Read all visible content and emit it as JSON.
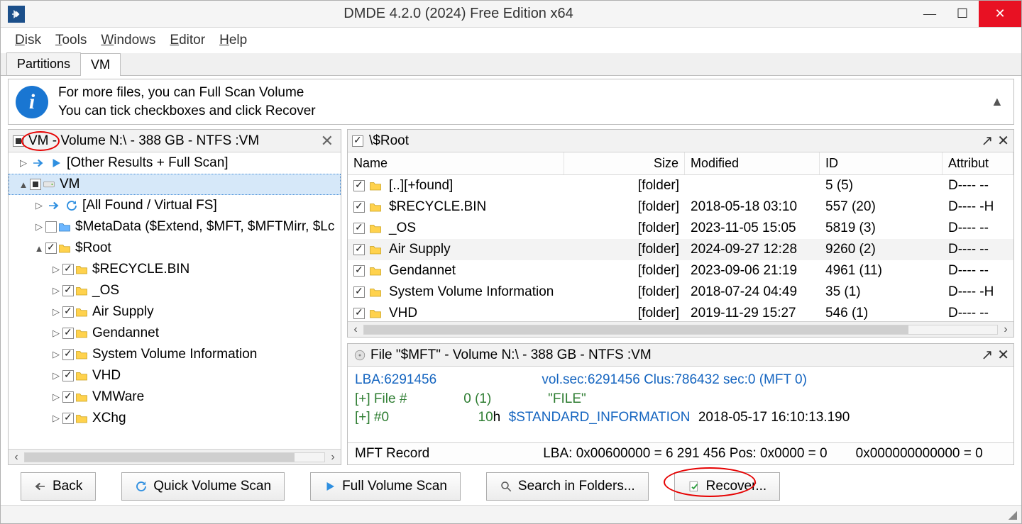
{
  "titlebar": {
    "title": "DMDE 4.2.0 (2024) Free Edition x64"
  },
  "menu": {
    "disk": "Disk",
    "tools": "Tools",
    "windows": "Windows",
    "editor": "Editor",
    "help": "Help"
  },
  "tabs": {
    "partitions": "Partitions",
    "vm": "VM"
  },
  "info": {
    "line1": "For more files, you can Full Scan Volume",
    "line2": "You can tick checkboxes and click Recover"
  },
  "left": {
    "header": "VM - Volume N:\\ - 388 GB - NTFS :VM",
    "nodes": {
      "other": "[Other Results + Full Scan]",
      "vm": "VM",
      "allfound": "[All Found / Virtual FS]",
      "metadata": "$MetaData ($Extend, $MFT, $MFTMirr, $Lc",
      "root": "$Root",
      "recycle": "$RECYCLE.BIN",
      "os": "_OS",
      "airsupply": "Air Supply",
      "gendannet": "Gendannet",
      "svi": "System Volume Information",
      "vhd": "VHD",
      "vmware": "VMWare",
      "xchg": "XChg"
    }
  },
  "listHeader": {
    "path": "\\$Root"
  },
  "grid": {
    "cols": {
      "name": "Name",
      "size": "Size",
      "mod": "Modified",
      "id": "ID",
      "attr": "Attribut"
    },
    "rows": [
      {
        "name": "[..][+found]",
        "size": "[folder]",
        "mod": "",
        "id": "5 (5)",
        "attr": "D---- --"
      },
      {
        "name": "$RECYCLE.BIN",
        "size": "[folder]",
        "mod": "2018-05-18 03:10",
        "id": "557 (20)",
        "attr": "D---- -H"
      },
      {
        "name": "_OS",
        "size": "[folder]",
        "mod": "2023-11-05 15:05",
        "id": "5819 (3)",
        "attr": "D---- --"
      },
      {
        "name": "Air Supply",
        "size": "[folder]",
        "mod": "2024-09-27 12:28",
        "id": "9260 (2)",
        "attr": "D---- --"
      },
      {
        "name": "Gendannet",
        "size": "[folder]",
        "mod": "2023-09-06 21:19",
        "id": "4961 (11)",
        "attr": "D---- --"
      },
      {
        "name": "System Volume Information",
        "size": "[folder]",
        "mod": "2018-07-24 04:49",
        "id": "35 (1)",
        "attr": "D---- -H"
      },
      {
        "name": "VHD",
        "size": "[folder]",
        "mod": "2019-11-29 15:27",
        "id": "546 (1)",
        "attr": "D---- --"
      }
    ]
  },
  "detail": {
    "title": "File \"$MFT\" - Volume N:\\ - 388 GB - NTFS :VM",
    "line1a": "LBA:6291456",
    "line1b": "vol.sec:6291456 Clus:786432 sec:0 (MFT 0)",
    "line2a": "[+] File #",
    "line2b": "0 (1)",
    "line2c": "\"FILE\"",
    "line3a": "[+] #0",
    "line3b": "10",
    "line3c": "h",
    "line3d": "$STANDARD_INFORMATION",
    "line3e": "2018-05-17 16:10:13.190",
    "status_a": "MFT Record",
    "status_b": "LBA: 0x00600000 = 6 291 456  Pos: 0x0000 = 0",
    "status_c": "0x000000000000 = 0"
  },
  "buttons": {
    "back": "Back",
    "quick": "Quick Volume Scan",
    "full": "Full Volume Scan",
    "search": "Search in Folders...",
    "recover": "Recover..."
  }
}
